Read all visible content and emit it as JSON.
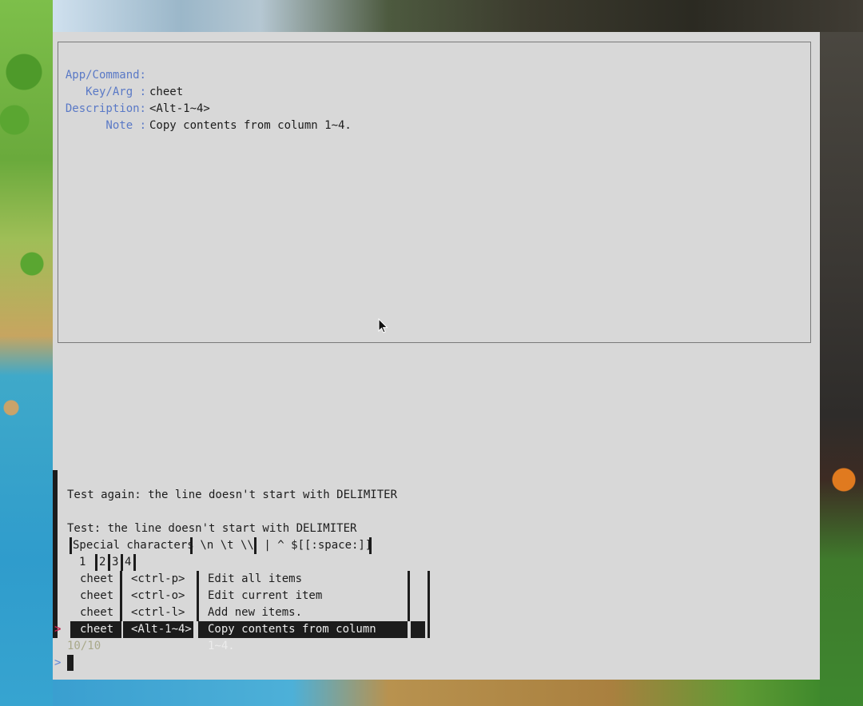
{
  "preview": {
    "fields": [
      {
        "label": "App/Command:",
        "value": "cheet"
      },
      {
        "label": "Key/Arg :",
        "value": "<Alt-1~4>"
      },
      {
        "label": "Description:",
        "value": "Copy contents from column 1~4."
      },
      {
        "label": "Note :",
        "value": ""
      }
    ]
  },
  "header_lines": {
    "line1": "Test again: the line doesn't start with DELIMITER",
    "line2": "Test: the line doesn't start with DELIMITER",
    "special_label": "Special characters",
    "special_chars": " \\n \\t \\\\",
    "special_rest": " | ^ $[[:space:]]",
    "columns": [
      "1",
      "2",
      "3",
      "4"
    ]
  },
  "rows": [
    {
      "app": "cheet",
      "key": "<ctrl-p>",
      "desc": "Edit all items"
    },
    {
      "app": "cheet",
      "key": "<ctrl-o>",
      "desc": "Edit current item"
    },
    {
      "app": "cheet",
      "key": "<ctrl-l>",
      "desc": "Add new items."
    }
  ],
  "selected_row": {
    "app": "cheet",
    "key": "<Alt-1~4>",
    "desc": "Copy contents from column 1~4."
  },
  "pointer": ">",
  "counter": "10/10",
  "prompt": ">",
  "colors": {
    "terminal_bg": "#d8d8d8",
    "label": "#5a79c6",
    "pointer": "#c0234d",
    "counter": "#a9a98a",
    "prompt": "#5f87d7"
  }
}
